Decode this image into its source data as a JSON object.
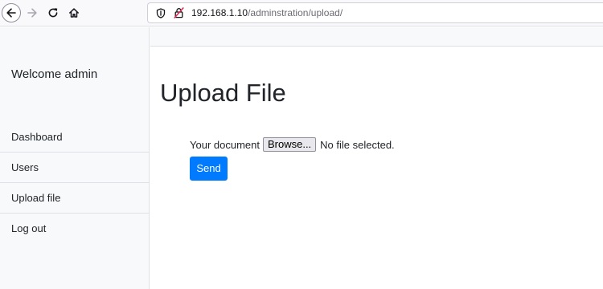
{
  "browser": {
    "url_host": "192.168.1.10",
    "url_path": "/adminstration/upload/",
    "icons": {
      "back": "arrow-left-icon",
      "forward": "arrow-right-icon",
      "reload": "reload-icon",
      "home": "home-icon",
      "tracking": "shield-icon",
      "security": "lock-off-icon"
    }
  },
  "sidebar": {
    "welcome": "Welcome admin",
    "items": [
      {
        "label": "Dashboard"
      },
      {
        "label": "Users"
      },
      {
        "label": "Upload file"
      },
      {
        "label": "Log out"
      }
    ]
  },
  "main": {
    "title": "Upload File",
    "form": {
      "document_label": "Your document",
      "browse_label": "Browse...",
      "no_file_text": "No file selected.",
      "send_label": "Send"
    }
  },
  "colors": {
    "primary": "#007bff",
    "insecure_icon": "#e22850",
    "sidebar_bg": "#f8f9fa"
  }
}
